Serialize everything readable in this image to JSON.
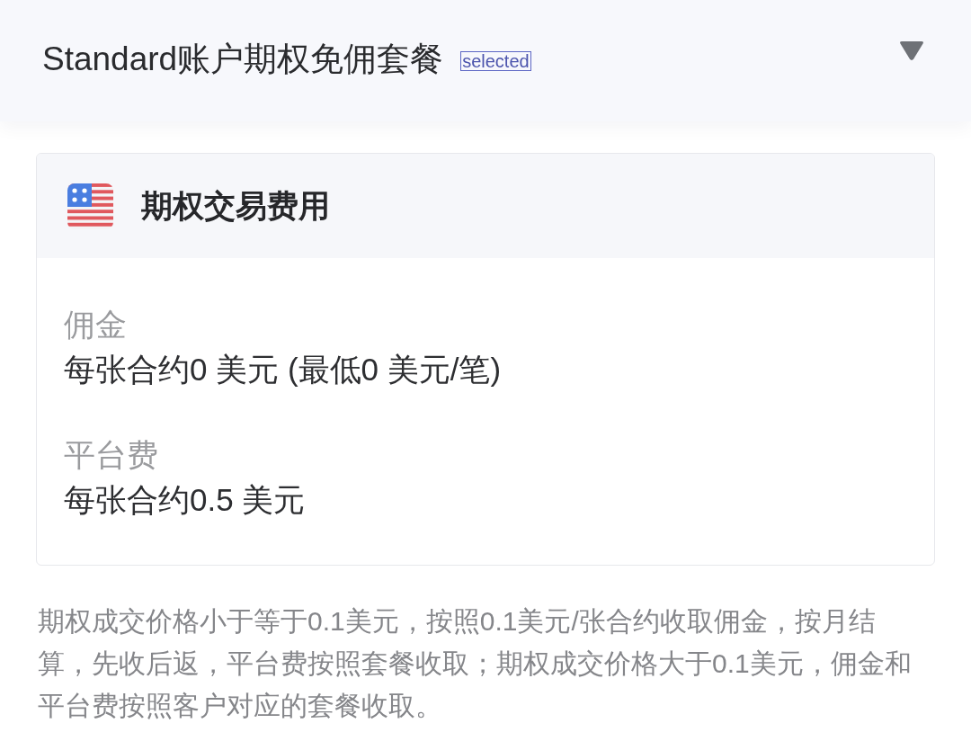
{
  "header": {
    "title": "Standard账户期权免佣套餐",
    "tag": "selected"
  },
  "card": {
    "title": "期权交易费用",
    "fees": [
      {
        "label": "佣金",
        "value": "每张合约0 美元 (最低0 美元/笔)"
      },
      {
        "label": "平台费",
        "value": "每张合约0.5 美元"
      }
    ]
  },
  "note": "期权成交价格小于等于0.1美元，按照0.1美元/张合约收取佣金，按月结算，先收后返，平台费按照套餐收取；期权成交价格大于0.1美元，佣金和平台费按照客户对应的套餐收取。"
}
